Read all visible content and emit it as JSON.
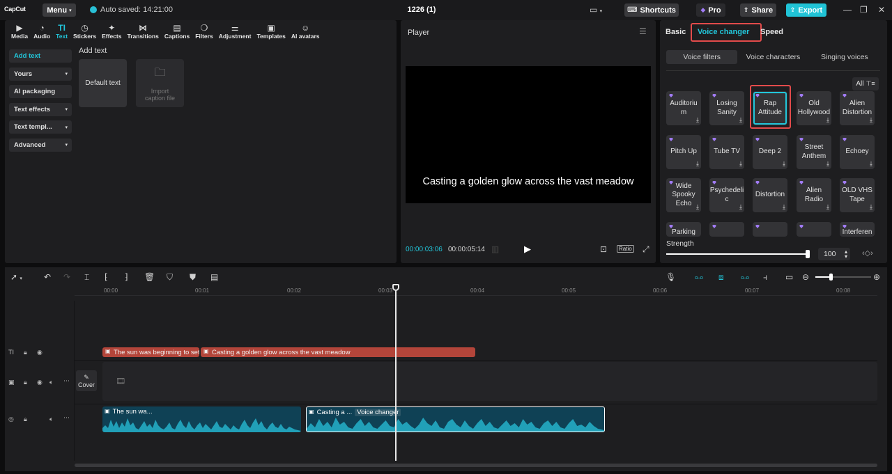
{
  "app": {
    "logo": "CapCut",
    "menu_label": "Menu",
    "autosave": "Auto saved: 14:21:00",
    "project_title": "1226 (1)",
    "shortcuts_label": "Shortcuts",
    "pro_label": "Pro",
    "share_label": "Share",
    "export_label": "Export"
  },
  "toolbar": {
    "items": [
      {
        "label": "Media",
        "icon": "media-icon"
      },
      {
        "label": "Audio",
        "icon": "audio-icon"
      },
      {
        "label": "Text",
        "icon": "text-icon",
        "active": true
      },
      {
        "label": "Stickers",
        "icon": "stickers-icon"
      },
      {
        "label": "Effects",
        "icon": "effects-icon"
      },
      {
        "label": "Transitions",
        "icon": "transitions-icon"
      },
      {
        "label": "Captions",
        "icon": "captions-icon"
      },
      {
        "label": "Filters",
        "icon": "filters-icon"
      },
      {
        "label": "Adjustment",
        "icon": "adjustment-icon"
      },
      {
        "label": "Templates",
        "icon": "templates-icon"
      },
      {
        "label": "AI avatars",
        "icon": "ai-avatars-icon"
      }
    ]
  },
  "sidenav": {
    "items": [
      {
        "label": "Add text",
        "active": true,
        "chevron": false
      },
      {
        "label": "Yours",
        "chevron": true
      },
      {
        "label": "AI packaging",
        "chevron": false
      },
      {
        "label": "Text effects",
        "chevron": true
      },
      {
        "label": "Text templ...",
        "chevron": true
      },
      {
        "label": "Advanced",
        "chevron": true
      }
    ]
  },
  "text_panel": {
    "heading": "Add text",
    "default_card": "Default text",
    "import_card_line1": "Import",
    "import_card_line2": "caption file"
  },
  "player": {
    "title": "Player",
    "caption": "Casting a golden glow across the vast meadow",
    "current_time": "00:00:03:06",
    "total_time": "00:00:05:14",
    "ratio_label": "Ratio"
  },
  "props": {
    "tabs": [
      {
        "label": "Basic"
      },
      {
        "label": "Voice changer",
        "active": true
      },
      {
        "label": "Speed"
      }
    ],
    "subtabs": [
      {
        "label": "Voice filters",
        "active": true
      },
      {
        "label": "Voice characters"
      },
      {
        "label": "Singing voices"
      }
    ],
    "all_label": "All",
    "voices": [
      [
        "Auditoriu m",
        "Losing Sanity",
        "Rap Attitude",
        "Old Hollywood",
        "Alien Distortion"
      ],
      [
        "Pitch Up",
        "Tube TV",
        "Deep 2",
        "Street Anthem",
        "Echoey"
      ],
      [
        "Wide Spooky Echo",
        "Psychedeli c",
        "Distortion",
        "Alien Radio",
        "OLD VHS Tape"
      ],
      [
        "Parking",
        "",
        "",
        "",
        "Interferen"
      ]
    ],
    "selected_voice": "Rap Attitude",
    "strength_label": "Strength",
    "strength_value": "100"
  },
  "timeline": {
    "ruler": [
      "00:00",
      "00:01",
      "00:02",
      "00:03",
      "00:04",
      "00:05",
      "00:06",
      "00:07",
      "00:08"
    ],
    "text_clips": [
      {
        "label": "The sun was beginning to set"
      },
      {
        "label": "Casting a golden glow across the vast meadow"
      }
    ],
    "cover_label": "Cover",
    "audio_clips": [
      {
        "label": "The sun wa..."
      },
      {
        "label": "Casting a ...",
        "tag": "Voice changer"
      }
    ]
  }
}
